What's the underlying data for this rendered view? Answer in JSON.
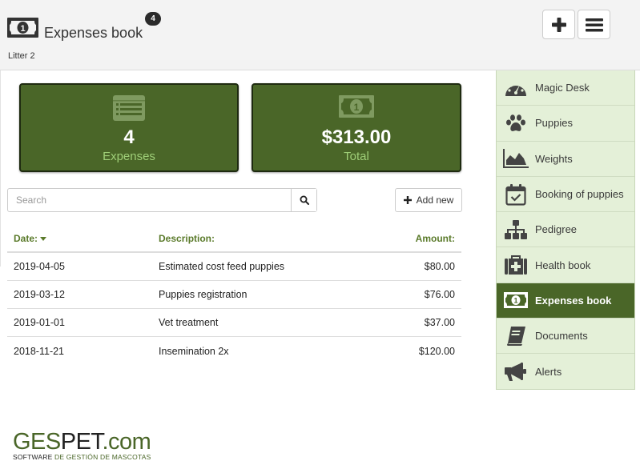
{
  "header": {
    "title": "Expenses book",
    "badge_count": "4",
    "subtitle": "Litter 2",
    "title_icon": "money-bill-icon",
    "buttons": [
      {
        "name": "add",
        "icon": "plus-icon"
      },
      {
        "name": "menu",
        "icon": "hamburger-menu-icon"
      }
    ]
  },
  "stats": {
    "expenses": {
      "value": "4",
      "label": "Expenses",
      "icon": "list-icon"
    },
    "total": {
      "value": "$313.00",
      "label": "Total",
      "icon": "money-bill-icon"
    }
  },
  "search": {
    "placeholder": "Search",
    "value": "",
    "icon": "search-icon"
  },
  "add_new": {
    "label": "Add new",
    "icon": "plus-icon"
  },
  "table": {
    "columns": [
      "Date:",
      "Description:",
      "Amount:"
    ],
    "sort_column": "Date:",
    "sort_direction": "descending",
    "rows": [
      {
        "date": "2019-04-05",
        "description": "Estimated cost feed puppies",
        "amount": "$80.00"
      },
      {
        "date": "2019-03-12",
        "description": "Puppies registration",
        "amount": "$76.00"
      },
      {
        "date": "2019-01-01",
        "description": "Vet treatment",
        "amount": "$37.00"
      },
      {
        "date": "2018-11-21",
        "description": "Insemination 2x",
        "amount": "$120.00"
      }
    ]
  },
  "sidebar": {
    "items": [
      {
        "label": "Magic Desk",
        "icon": "dashboard-gauge-icon",
        "active": false
      },
      {
        "label": "Puppies",
        "icon": "paw-icon",
        "active": false
      },
      {
        "label": "Weights",
        "icon": "area-chart-icon",
        "active": false
      },
      {
        "label": "Booking of puppies",
        "icon": "calendar-check-icon",
        "active": false
      },
      {
        "label": "Pedigree",
        "icon": "sitemap-icon",
        "active": false
      },
      {
        "label": "Health book",
        "icon": "medkit-icon",
        "active": false
      },
      {
        "label": "Expenses book",
        "icon": "money-bill-icon",
        "active": true
      },
      {
        "label": "Documents",
        "icon": "book-icon",
        "active": false
      },
      {
        "label": "Alerts",
        "icon": "bullhorn-icon",
        "active": false
      }
    ]
  },
  "logo": {
    "part1": "GES",
    "part2": "PET",
    "part3": ".com",
    "tagline_a": "SOFTWARE ",
    "tagline_b": "DE GESTIÓN DE MASCOTAS"
  },
  "colors": {
    "brand_green": "#4a6628",
    "sidebar_bg": "#e4f0d8",
    "header_link_green": "#5a7a2a",
    "stat_label_green": "#9fcf78"
  }
}
